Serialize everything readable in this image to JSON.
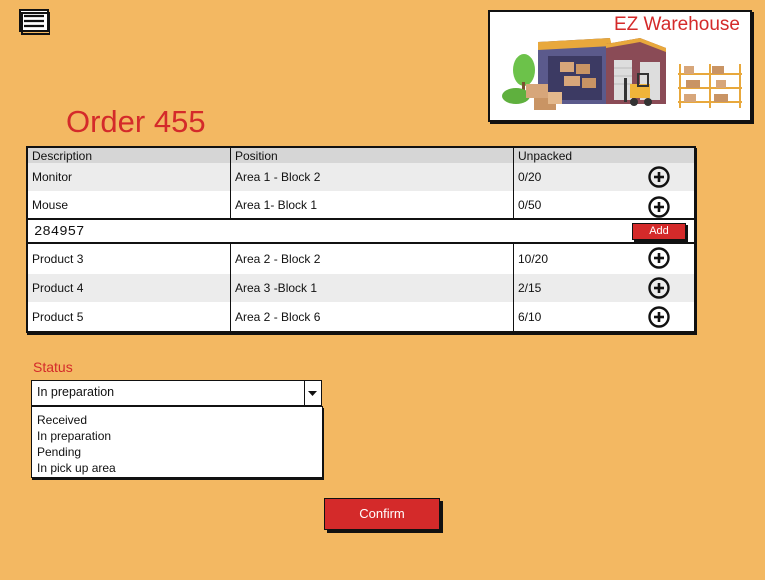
{
  "app": {
    "brand": "EZ Warehouse"
  },
  "order": {
    "title": "Order 455"
  },
  "table": {
    "columns": [
      "Description",
      "Position",
      "Unpacked"
    ],
    "rows": [
      {
        "description": "Monitor",
        "position": "Area 1 - Block 2",
        "unpacked": "0/20"
      },
      {
        "description": "Mouse",
        "position": "Area 1- Block 1",
        "unpacked": "0/50"
      },
      {
        "description": "Product 3",
        "position": "Area 2 - Block 2",
        "unpacked": "10/20"
      },
      {
        "description": "Product 4",
        "position": "Area 3 -Block 1",
        "unpacked": "2/15"
      },
      {
        "description": "Product 5",
        "position": "Area 2 - Block 6",
        "unpacked": "6/10"
      }
    ],
    "serial_input": {
      "value": "284957"
    },
    "add_label": "Add"
  },
  "status": {
    "label": "Status",
    "selected": "In preparation",
    "options": [
      "Received",
      "In preparation",
      "Pending",
      "In pick up area"
    ]
  },
  "confirm_label": "Confirm",
  "icons": {
    "menu": "hamburger-menu-icon",
    "add": "plus-circle-icon",
    "dropdown": "chevron-down-icon"
  },
  "colors": {
    "background": "#f3b862",
    "accent": "#d42a2a"
  }
}
